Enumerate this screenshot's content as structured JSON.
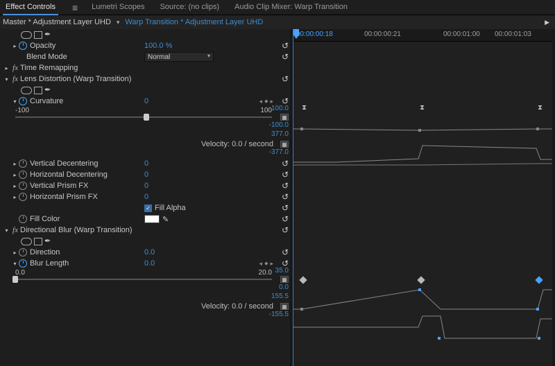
{
  "tabs": {
    "effect_controls": "Effect Controls",
    "lumetri_scopes": "Lumetri Scopes",
    "source": "Source: (no clips)",
    "audio_clip_mixer": "Audio Clip Mixer: Warp Transition"
  },
  "header": {
    "master": "Master * Adjustment Layer UHD",
    "clip": "Warp Transition * Adjustment Layer UHD"
  },
  "timeline": {
    "current": "00:00:00:18",
    "t2": "00:00:00:21",
    "t3": "00:00:01:00",
    "t4": "00:00:01:03"
  },
  "opacity": {
    "label": "Opacity",
    "value": "100.0 %",
    "blend_mode_label": "Blend Mode",
    "blend_mode_value": "Normal"
  },
  "time_remapping": {
    "label": "Time Remapping"
  },
  "lens": {
    "title": "Lens Distortion (Warp Transition)",
    "curvature": {
      "label": "Curvature",
      "value": "0"
    },
    "curv_slider": {
      "min": "-100",
      "max": "100"
    },
    "curv_scale": {
      "top": "100.0",
      "bot": "-100.0"
    },
    "vel_scale": {
      "top": "377.0",
      "bot": "-377.0"
    },
    "velocity": "Velocity: 0.0 / second",
    "params": {
      "v_decenter": {
        "label": "Vertical Decentering",
        "value": "0"
      },
      "h_decenter": {
        "label": "Horizontal Decentering",
        "value": "0"
      },
      "v_prism": {
        "label": "Vertical Prism FX",
        "value": "0"
      },
      "h_prism": {
        "label": "Horizontal Prism FX",
        "value": "0"
      }
    },
    "fill_alpha": "Fill Alpha",
    "fill_color": "Fill Color"
  },
  "blur": {
    "title": "Directional Blur (Warp Transition)",
    "direction": {
      "label": "Direction",
      "value": "0.0"
    },
    "length": {
      "label": "Blur Length",
      "value": "0.0"
    },
    "len_slider": {
      "min": "0.0",
      "max": "20.0"
    },
    "len_scale": {
      "top": "35.0",
      "bot": "0.0"
    },
    "len_vel_scale": {
      "top": "155.5",
      "bot": "-155.5"
    },
    "velocity": "Velocity: 0.0 / second"
  },
  "chart_data": [
    {
      "type": "line",
      "title": "Curvature value",
      "x": [
        "00:00:00:18",
        "00:00:00:21",
        "00:00:01:00",
        "00:00:01:03"
      ],
      "series": [
        {
          "name": "Curvature",
          "values": [
            0,
            0,
            -8,
            0
          ]
        }
      ],
      "ylim": [
        -100,
        100
      ]
    },
    {
      "type": "line",
      "title": "Curvature velocity",
      "x": [
        "00:00:00:18",
        "00:00:00:21",
        "00:00:01:00",
        "00:00:01:03"
      ],
      "series": [
        {
          "name": "Velocity",
          "values": [
            0,
            0,
            350,
            -40
          ]
        }
      ],
      "ylim": [
        -377,
        377
      ]
    },
    {
      "type": "line",
      "title": "Blur Length value",
      "x": [
        "00:00:00:18",
        "00:00:00:21",
        "00:00:01:00",
        "00:00:01:03"
      ],
      "series": [
        {
          "name": "Blur Length",
          "values": [
            0,
            30,
            0,
            30
          ]
        }
      ],
      "ylim": [
        0,
        35
      ]
    },
    {
      "type": "line",
      "title": "Blur Length velocity",
      "x": [
        "00:00:00:18",
        "00:00:00:21",
        "00:00:01:00",
        "00:00:01:03"
      ],
      "series": [
        {
          "name": "Velocity",
          "values": [
            0,
            0,
            140,
            -70
          ]
        }
      ],
      "ylim": [
        -155.5,
        155.5
      ]
    }
  ]
}
